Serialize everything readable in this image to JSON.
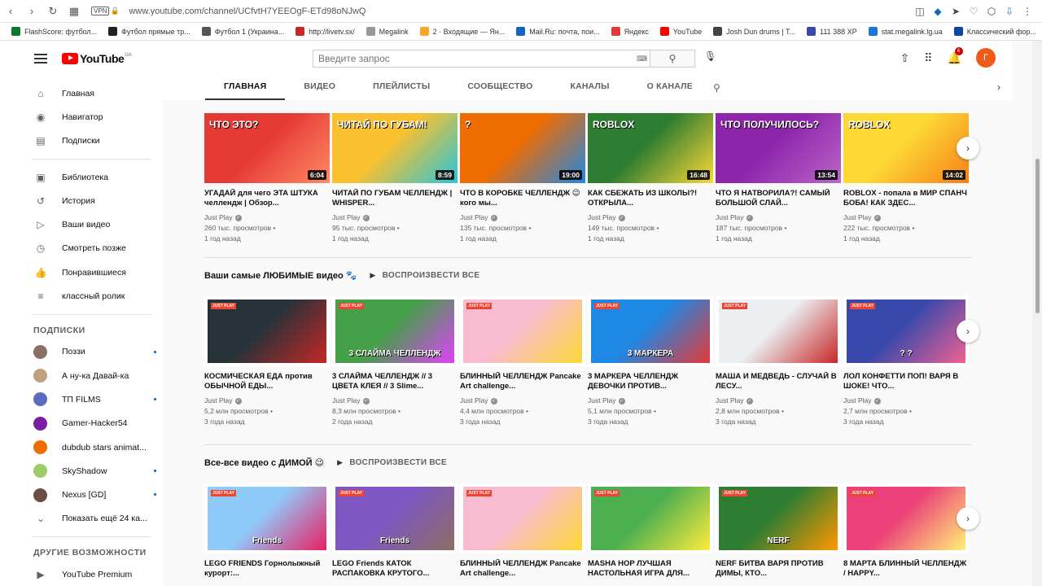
{
  "browser": {
    "url": "www.youtube.com/channel/UCfvtH7YEEOgF-ETd98oNJwQ",
    "vpn_label": "VPN",
    "bookmarks": [
      {
        "label": "FlashScore: футбол...",
        "color": "#0b7a26"
      },
      {
        "label": "Футбол прямые тр...",
        "color": "#222222"
      },
      {
        "label": "Футбол 1 (Украина...",
        "color": "#555555"
      },
      {
        "label": "http://livetv.sx/",
        "color": "#c62828"
      },
      {
        "label": "Megalink",
        "color": "#999999"
      },
      {
        "label": "2 · Входящие — Ян...",
        "color": "#f9a825"
      },
      {
        "label": "Mail.Ru: почта, пои...",
        "color": "#1565c0"
      },
      {
        "label": "Яндекс",
        "color": "#e53935"
      },
      {
        "label": "YouTube",
        "color": "#ff0000"
      },
      {
        "label": "Josh Dun drums | T...",
        "color": "#444444"
      },
      {
        "label": "111 388 XP",
        "color": "#3949ab"
      },
      {
        "label": "stat.megalink.lg.ua",
        "color": "#1976d2"
      },
      {
        "label": "Классический фор...",
        "color": "#0d47a1"
      }
    ]
  },
  "header": {
    "logo_text": "YouTube",
    "logo_region": "UA",
    "search_placeholder": "Введите запрос",
    "notification_count": "6",
    "avatar_letter": "Г"
  },
  "sidebar": {
    "main_items": [
      {
        "label": "Главная",
        "icon": "⌂"
      },
      {
        "label": "Навигатор",
        "icon": "◉"
      },
      {
        "label": "Подписки",
        "icon": "▤"
      }
    ],
    "library_items": [
      {
        "label": "Библиотека",
        "icon": "▣"
      },
      {
        "label": "История",
        "icon": "↺"
      },
      {
        "label": "Ваши видео",
        "icon": "▷"
      },
      {
        "label": "Смотреть позже",
        "icon": "◷"
      },
      {
        "label": "Понравившиеся",
        "icon": "👍"
      },
      {
        "label": "классный ролик",
        "icon": "≡"
      }
    ],
    "subs_title": "ПОДПИСКИ",
    "subscriptions": [
      {
        "label": "Поззи",
        "color": "#8d6e63",
        "dot": true
      },
      {
        "label": "А ну-ка Давай-ка",
        "color": "#c0a080",
        "dot": false
      },
      {
        "label": "ТП FILMS",
        "color": "#5c6bc0",
        "dot": true
      },
      {
        "label": "Gamer-Hacker54",
        "color": "#7b1fa2",
        "dot": false
      },
      {
        "label": "dubdub stars animat...",
        "color": "#ef6c00",
        "dot": false
      },
      {
        "label": "SkyShadow",
        "color": "#9ccc65",
        "dot": true
      },
      {
        "label": "Nexus [GD]",
        "color": "#6d4c41",
        "dot": true
      }
    ],
    "show_more": "Показать ещё 24 ка...",
    "other_title": "ДРУГИЕ ВОЗМОЖНОСТИ",
    "premium": "YouTube Premium"
  },
  "tabs": [
    "ГЛАВНАЯ",
    "ВИДЕО",
    "ПЛЕЙЛИСТЫ",
    "СООБЩЕСТВО",
    "КАНАЛЫ",
    "О КАНАЛЕ"
  ],
  "shelves": [
    {
      "title": "",
      "play_all": "",
      "videos": [
        {
          "title": "УГАДАЙ для чего ЭТА ШТУКА челлендж | Обзор...",
          "channel": "Just Play",
          "views": "260 тыс. просмотров",
          "age": "1 год назад",
          "duration": "6:04",
          "thumb_text": "ЧТО ЭТО?",
          "color": "#e53935",
          "color2": "#ff8a65"
        },
        {
          "title": "ЧИТАЙ ПО ГУБАМ ЧЕЛЛЕНДЖ | WHISPER...",
          "channel": "Just Play",
          "views": "95 тыс. просмотров",
          "age": "1 год назад",
          "duration": "8:59",
          "thumb_text": "ЧИТАЙ ПО ГУБАМ!",
          "color": "#fbc02d",
          "color2": "#26c6da"
        },
        {
          "title": "ЧТО В КОРОБКЕ ЧЕЛЛЕНДЖ 😉 кого мы...",
          "channel": "Just Play",
          "views": "135 тыс. просмотров",
          "age": "1 год назад",
          "duration": "19:00",
          "thumb_text": "?",
          "color": "#ef6c00",
          "color2": "#1e88e5"
        },
        {
          "title": "КАК СБЕЖАТЬ ИЗ ШКОЛЫ?! ОТКРЫЛА...",
          "channel": "Just Play",
          "views": "149 тыс. просмотров",
          "age": "1 год назад",
          "duration": "16:48",
          "thumb_text": "ROBLOX",
          "color": "#2e7d32",
          "color2": "#fdd835"
        },
        {
          "title": "ЧТО Я НАТВОРИЛА?! САМЫЙ БОЛЬШОЙ СЛАЙ...",
          "channel": "Just Play",
          "views": "187 тыс. просмотров",
          "age": "1 год назад",
          "duration": "13:54",
          "thumb_text": "ЧТО ПОЛУЧИЛОСЬ?",
          "color": "#8e24aa",
          "color2": "#ba68c8"
        },
        {
          "title": "ROBLOX - попала в МИР СПАНЧ БОБА! КАК ЗДЕС...",
          "channel": "Just Play",
          "views": "222 тыс. просмотров",
          "age": "1 год назад",
          "duration": "14:02",
          "thumb_text": "ROBLOX",
          "color": "#fdd835",
          "color2": "#f57f17"
        }
      ]
    },
    {
      "title": "Ваши самые ЛЮБИМЫЕ видео 🐾",
      "play_all": "ВОСПРОИЗВЕСТИ ВСЕ",
      "videos": [
        {
          "title": "КОСМИЧЕСКАЯ ЕДА против ОБЫЧНОЙ ЕДЫ...",
          "channel": "Just Play",
          "views": "5,2 млн просмотров",
          "age": "3 года назад",
          "duration": "",
          "thumb_text": "",
          "color": "#263238",
          "color2": "#c62828"
        },
        {
          "title": "3 СЛАЙМА ЧЕЛЛЕНДЖ // 3 ЦВЕТА КЛЕЯ // 3 Slime...",
          "channel": "Just Play",
          "views": "8,3 млн просмотров",
          "age": "2 года назад",
          "duration": "",
          "thumb_text": "3 СЛАЙМА ЧЕЛЛЕНДЖ",
          "color": "#43a047",
          "color2": "#e040fb"
        },
        {
          "title": "БЛИННЫЙ ЧЕЛЛЕНДЖ Pancake Art challenge...",
          "channel": "Just Play",
          "views": "4,4 млн просмотров",
          "age": "3 года назад",
          "duration": "",
          "thumb_text": "",
          "color": "#f8bbd0",
          "color2": "#fdd835"
        },
        {
          "title": "3 МАРКЕРА ЧЕЛЛЕНДЖ ДЕВОЧКИ ПРОТИВ...",
          "channel": "Just Play",
          "views": "5,1 млн просмотров",
          "age": "3 года назад",
          "duration": "",
          "thumb_text": "3 МАРКЕРА",
          "color": "#1e88e5",
          "color2": "#e53935"
        },
        {
          "title": "МАША И МЕДВЕДЬ - СЛУЧАЙ В ЛЕСУ...",
          "channel": "Just Play",
          "views": "2,8 млн просмотров",
          "age": "3 года назад",
          "duration": "",
          "thumb_text": "",
          "color": "#eceff1",
          "color2": "#c62828"
        },
        {
          "title": "ЛОЛ КОНФЕТТИ ПОП! ВАРЯ В ШОКЕ! ЧТО...",
          "channel": "Just Play",
          "views": "2,7 млн просмотров",
          "age": "3 года назад",
          "duration": "",
          "thumb_text": "? ?",
          "color": "#3949ab",
          "color2": "#f06292"
        }
      ]
    },
    {
      "title": "Все-все видео с ДИМОЙ 😉",
      "play_all": "ВОСПРОИЗВЕСТИ ВСЕ",
      "videos": [
        {
          "title": "LEGO FRIENDS Горнолыжный курорт:...",
          "channel": "",
          "views": "",
          "age": "",
          "duration": "",
          "thumb_text": "Friends",
          "color": "#90caf9",
          "color2": "#e91e63"
        },
        {
          "title": "LEGO Friends КАТОК РАСПАКОВКА КРУТОГО...",
          "channel": "",
          "views": "",
          "age": "",
          "duration": "",
          "thumb_text": "Friends",
          "color": "#7e57c2",
          "color2": "#8d6e63"
        },
        {
          "title": "БЛИННЫЙ ЧЕЛЛЕНДЖ Pancake Art challenge...",
          "channel": "",
          "views": "",
          "age": "",
          "duration": "",
          "thumb_text": "",
          "color": "#f8bbd0",
          "color2": "#fdd835"
        },
        {
          "title": "MASHA HOP ЛУЧШАЯ НАСТОЛЬНАЯ ИГРА ДЛЯ...",
          "channel": "",
          "views": "",
          "age": "",
          "duration": "",
          "thumb_text": "",
          "color": "#4caf50",
          "color2": "#ffeb3b"
        },
        {
          "title": "NERF БИТВА ВАРЯ ПРОТИВ ДИМЫ, КТО...",
          "channel": "",
          "views": "",
          "age": "",
          "duration": "",
          "thumb_text": "NERF",
          "color": "#2e7d32",
          "color2": "#ff9800"
        },
        {
          "title": "8 МАРТА БЛИННЫЙ ЧЕЛЛЕНДЖ / HAPPY...",
          "channel": "",
          "views": "",
          "age": "",
          "duration": "",
          "thumb_text": "",
          "color": "#ec407a",
          "color2": "#fff176"
        }
      ]
    }
  ],
  "badge_text": "JUST PLAY"
}
